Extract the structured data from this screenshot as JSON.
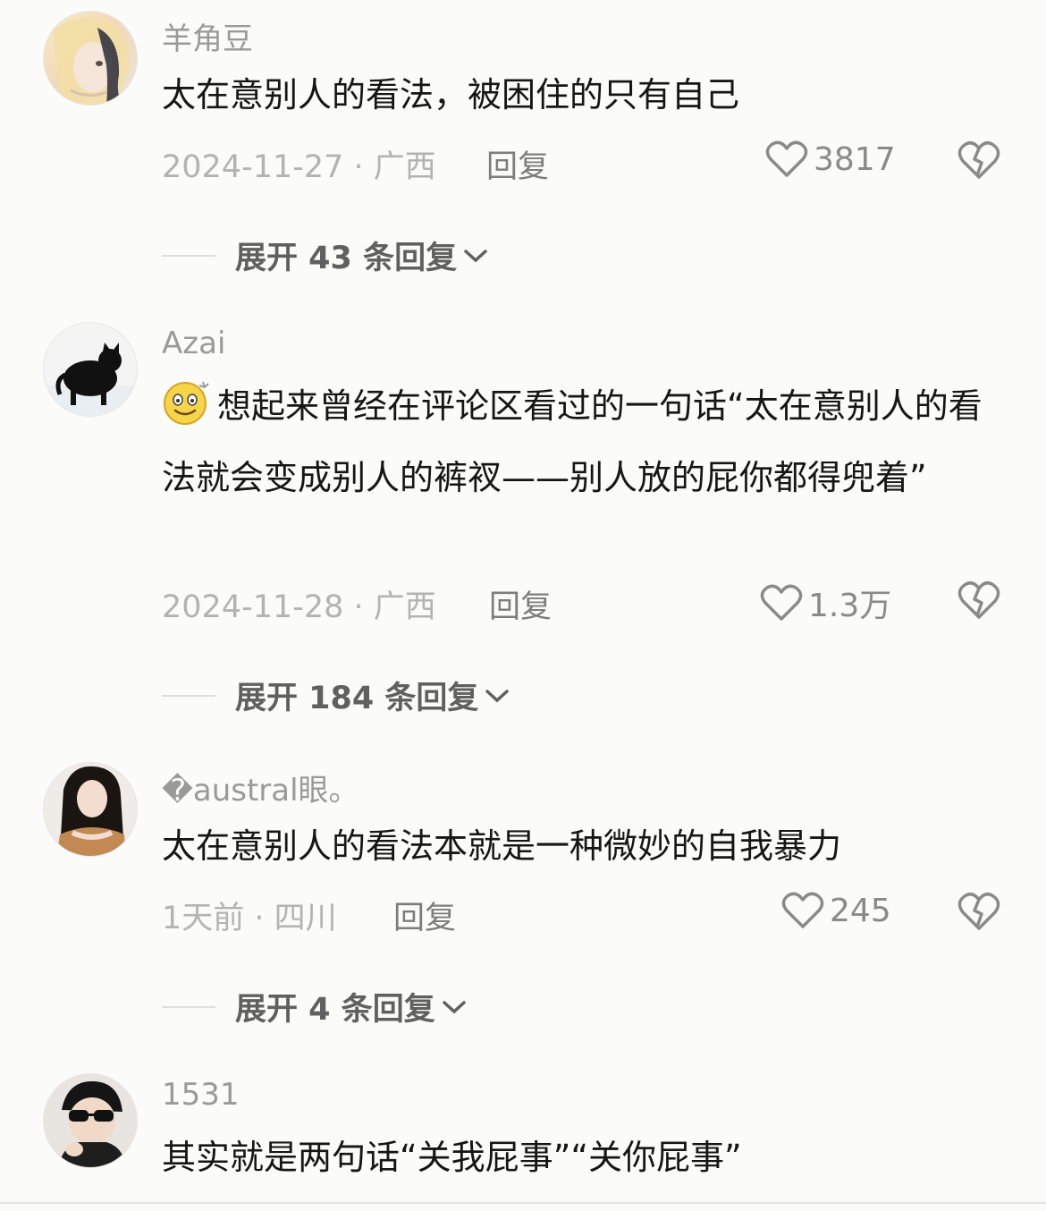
{
  "comments": [
    {
      "username": "羊角豆",
      "text": "太在意别人的看法，被困住的只有自己",
      "meta": "2024-11-27 · 广西",
      "reply_label": "回复",
      "likes": "3817",
      "expand_label": "展开 43 条回复",
      "avatar_icon": "anime-girl-avatar"
    },
    {
      "username": "Azai",
      "text": "想起来曾经在评论区看过的一句话“太在意别人的看法就会变成别人的裤衩——别人放的屁你都得兜着”",
      "meta": "2024-11-28 · 广西",
      "reply_label": "回复",
      "likes": "1.3万",
      "expand_label": "展开 184 条回复",
      "avatar_icon": "black-cat-avatar"
    },
    {
      "username": "�austral眼。",
      "text": "太在意别人的看法本就是一种微妙的自我暴力",
      "meta": "1天前 · 四川",
      "reply_label": "回复",
      "likes": "245",
      "expand_label": "展开 4 条回复",
      "avatar_icon": "girl-photo-avatar"
    },
    {
      "username": "1531",
      "text": "其实就是两句话“关我屁事”“关你屁事”",
      "avatar_icon": "sunglasses-boy-avatar"
    }
  ],
  "colors": {
    "background": "#fbfbf9",
    "muted": "#9a9a9a",
    "text": "#161616"
  }
}
